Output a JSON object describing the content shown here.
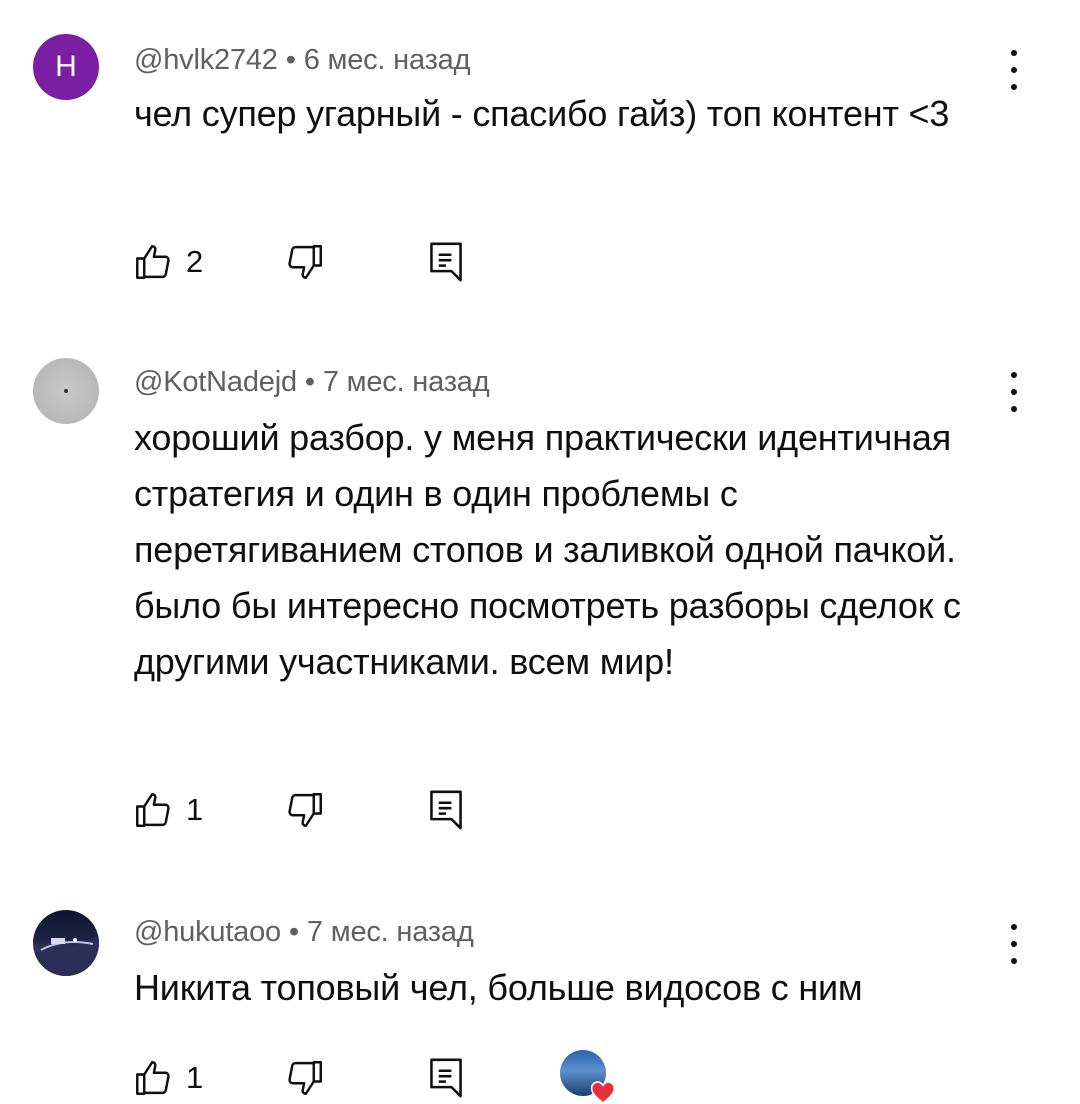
{
  "comments": [
    {
      "avatar_letter": "H",
      "avatar_color": "#7b1fa2",
      "handle": "@hvlk2742",
      "separator": "•",
      "time": "6 мес. назад",
      "text": "чел супер угарный - спасибо гайз) топ контент <3",
      "likes": "2",
      "creator_heart": false
    },
    {
      "avatar_letter": "",
      "handle": "@KotNadejd",
      "separator": "•",
      "time": "7 мес. назад",
      "text": "хороший разбор. у меня практически идентичная стратегия и один в один проблемы с перетягиванием стопов и заливкой одной пачкой. было бы интересно посмотреть разборы сделок с другими участниками. всем мир!",
      "likes": "1",
      "creator_heart": false
    },
    {
      "avatar_letter": "",
      "handle": "@hukutaoo",
      "separator": "•",
      "time": "7 мес. назад",
      "text": "Никита топовый чел, больше видосов с ним",
      "likes": "1",
      "creator_heart": true
    }
  ],
  "icons": {
    "like": "thumbs-up-icon",
    "dislike": "thumbs-down-icon",
    "reply": "reply-icon",
    "more": "more-vert-icon",
    "heart": "heart-icon"
  },
  "colors": {
    "text": "#0f0f0f",
    "meta": "#606060",
    "heart": "#e8303c"
  }
}
